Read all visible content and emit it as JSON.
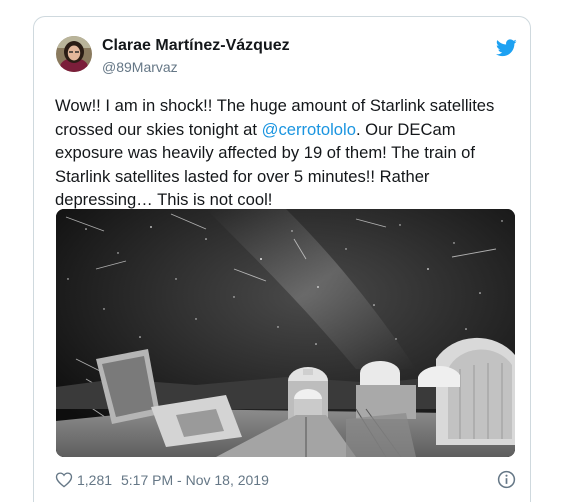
{
  "tweet": {
    "author_name": "Clarae Martínez-Vázquez",
    "author_handle": "@89Marvaz",
    "text_before": "Wow!! I am in shock!! The huge amount of Starlink satellites crossed our skies tonight at ",
    "mention": "@cerrotololo",
    "text_after": ". Our DECam exposure was heavily affected by 19 of them! The train of Starlink satellites lasted for over 5 minutes!! Rather depressing… This is not cool!",
    "like_count": "1,281",
    "timestamp": "5:17 PM - Nov 18, 2019"
  },
  "icons": {
    "brand": "twitter-bird-icon",
    "like": "heart-icon",
    "info": "info-icon"
  },
  "colors": {
    "brand_blue": "#1da1f2",
    "link_blue": "#1b95e0",
    "text_primary": "#14171a",
    "text_secondary": "#657786",
    "border": "#cfd9de"
  }
}
